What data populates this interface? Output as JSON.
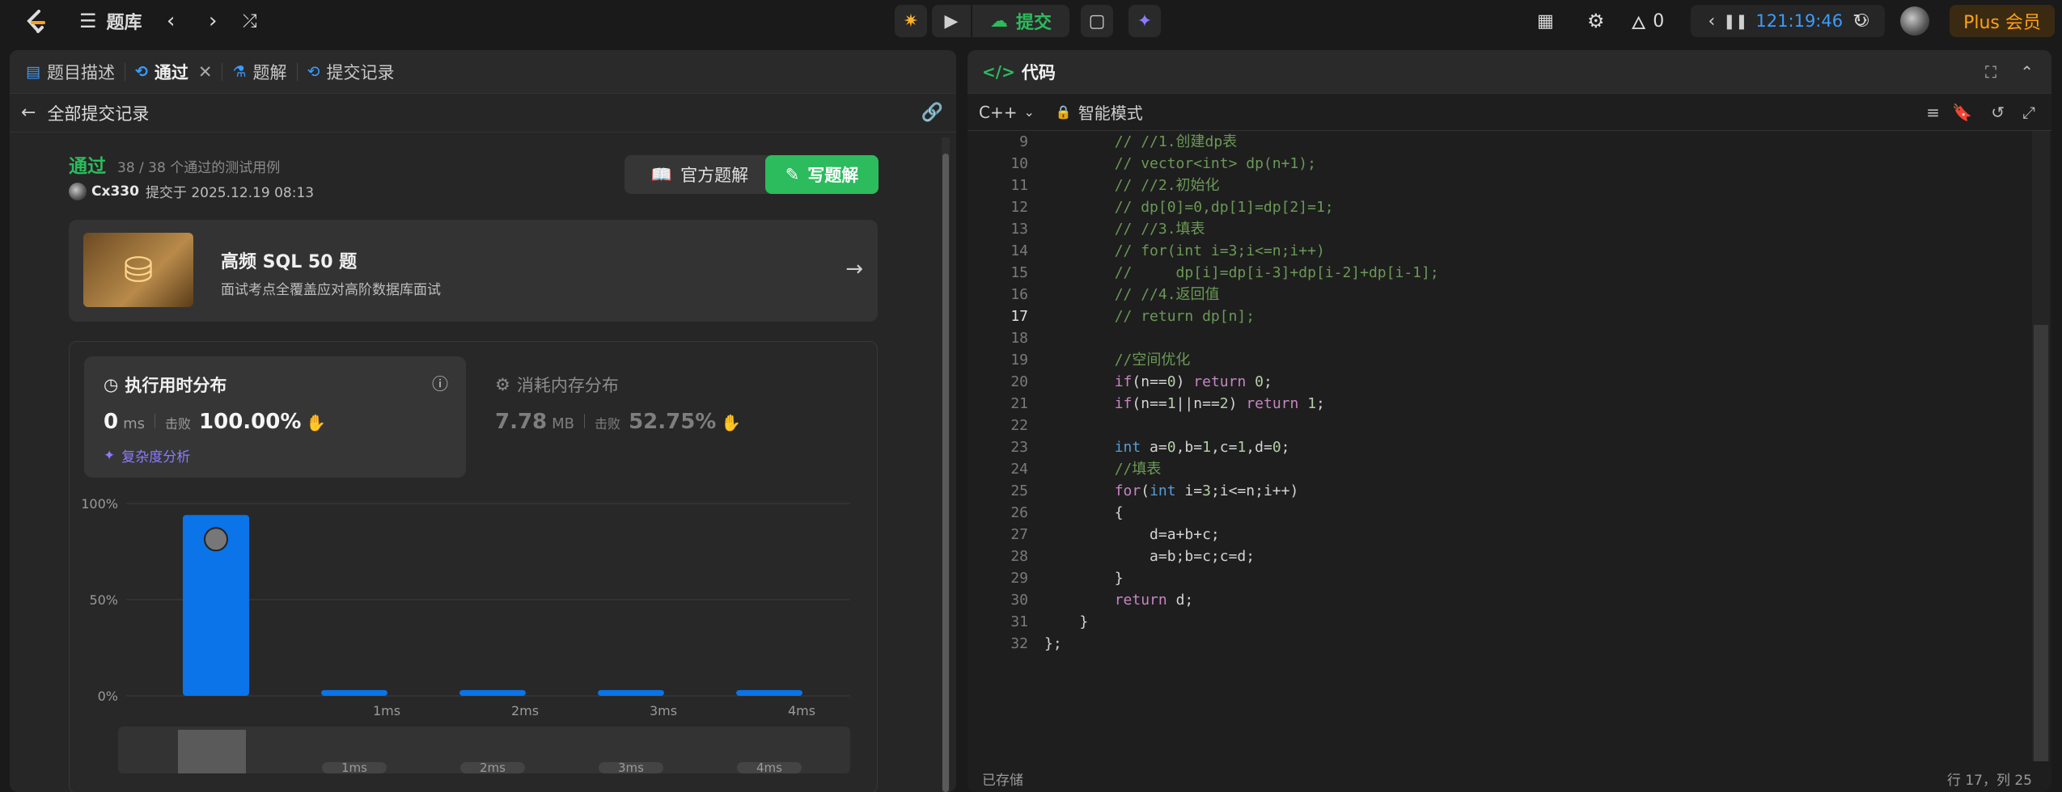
{
  "topbar": {
    "problem_bank": "题库",
    "submit": "提交",
    "fire_count": "0",
    "timer": "121:19:46",
    "plus": "Plus 会员"
  },
  "left": {
    "tabs": [
      {
        "label": "题目描述"
      },
      {
        "label": "通过"
      },
      {
        "label": "题解"
      },
      {
        "label": "提交记录"
      }
    ],
    "back_label": "全部提交记录",
    "status": "通过",
    "testcases": "38 / 38 个通过的测试用例",
    "user": "Cx330",
    "submitted_at": "提交于 2025.12.19 08:13",
    "official_solution": "官方题解",
    "write_solution": "写题解",
    "promo": {
      "title": "高频 SQL 50 题",
      "subtitle": "面试考点全覆盖应对高阶数据库面试"
    },
    "runtime": {
      "title": "执行用时分布",
      "value": "0",
      "unit": "ms",
      "beats_label": "击败",
      "beats": "100.00%",
      "complexity": "复杂度分析"
    },
    "memory": {
      "title": "消耗内存分布",
      "value": "7.78",
      "unit": "MB",
      "beats_label": "击败",
      "beats": "52.75%"
    },
    "chart_data": {
      "type": "bar",
      "categories": [
        "",
        "1ms",
        "2ms",
        "3ms",
        "4ms"
      ],
      "values": [
        94,
        3,
        3,
        3,
        3
      ],
      "y_ticks": [
        "100%",
        "50%",
        "0%"
      ],
      "ylim": [
        0,
        100
      ],
      "bar_color": "#0a74e8",
      "brush_labels": [
        "1ms",
        "2ms",
        "3ms",
        "4ms"
      ]
    }
  },
  "right": {
    "title": "代码",
    "language": "C++",
    "mode": "智能模式",
    "saved": "已存储",
    "cursor": "行 17，列 25",
    "current_line": 17,
    "lines": [
      {
        "n": "9",
        "parts": [
          {
            "t": "        // //1.创建dp表",
            "c": "cm"
          }
        ]
      },
      {
        "n": "10",
        "parts": [
          {
            "t": "        // vector<int> dp(n+1);",
            "c": "cm"
          }
        ]
      },
      {
        "n": "11",
        "parts": [
          {
            "t": "        // //2.初始化",
            "c": "cm"
          }
        ]
      },
      {
        "n": "12",
        "parts": [
          {
            "t": "        // dp[0]=0,dp[1]=dp[2]=1;",
            "c": "cm"
          }
        ]
      },
      {
        "n": "13",
        "parts": [
          {
            "t": "        // //3.填表",
            "c": "cm"
          }
        ]
      },
      {
        "n": "14",
        "parts": [
          {
            "t": "        // for(int i=3;i<=n;i++)",
            "c": "cm"
          }
        ]
      },
      {
        "n": "15",
        "parts": [
          {
            "t": "        //     dp[i]=dp[i-3]+dp[i-2]+dp[i-1];",
            "c": "cm"
          }
        ]
      },
      {
        "n": "16",
        "parts": [
          {
            "t": "        // //4.返回值",
            "c": "cm"
          }
        ]
      },
      {
        "n": "17",
        "parts": [
          {
            "t": "        // return dp[n];",
            "c": "cm"
          }
        ]
      },
      {
        "n": "18",
        "parts": []
      },
      {
        "n": "19",
        "parts": [
          {
            "t": "        //空间优化",
            "c": "cm"
          }
        ]
      },
      {
        "n": "20",
        "parts": [
          {
            "t": "        ",
            "c": "df"
          },
          {
            "t": "if",
            "c": "kw"
          },
          {
            "t": "(n==",
            "c": "df"
          },
          {
            "t": "0",
            "c": "nm"
          },
          {
            "t": ") ",
            "c": "df"
          },
          {
            "t": "return",
            "c": "kw"
          },
          {
            "t": " ",
            "c": "df"
          },
          {
            "t": "0",
            "c": "nm"
          },
          {
            "t": ";",
            "c": "df"
          }
        ]
      },
      {
        "n": "21",
        "parts": [
          {
            "t": "        ",
            "c": "df"
          },
          {
            "t": "if",
            "c": "kw"
          },
          {
            "t": "(n==",
            "c": "df"
          },
          {
            "t": "1",
            "c": "nm"
          },
          {
            "t": "||n==",
            "c": "df"
          },
          {
            "t": "2",
            "c": "nm"
          },
          {
            "t": ") ",
            "c": "df"
          },
          {
            "t": "return",
            "c": "kw"
          },
          {
            "t": " ",
            "c": "df"
          },
          {
            "t": "1",
            "c": "nm"
          },
          {
            "t": ";",
            "c": "df"
          }
        ]
      },
      {
        "n": "22",
        "parts": []
      },
      {
        "n": "23",
        "parts": [
          {
            "t": "        ",
            "c": "df"
          },
          {
            "t": "int",
            "c": "ty"
          },
          {
            "t": " a=",
            "c": "df"
          },
          {
            "t": "0",
            "c": "nm"
          },
          {
            "t": ",b=",
            "c": "df"
          },
          {
            "t": "1",
            "c": "nm"
          },
          {
            "t": ",c=",
            "c": "df"
          },
          {
            "t": "1",
            "c": "nm"
          },
          {
            "t": ",d=",
            "c": "df"
          },
          {
            "t": "0",
            "c": "nm"
          },
          {
            "t": ";",
            "c": "df"
          }
        ]
      },
      {
        "n": "24",
        "parts": [
          {
            "t": "        //填表",
            "c": "cm"
          }
        ]
      },
      {
        "n": "25",
        "parts": [
          {
            "t": "        ",
            "c": "df"
          },
          {
            "t": "for",
            "c": "kw"
          },
          {
            "t": "(",
            "c": "df"
          },
          {
            "t": "int",
            "c": "ty"
          },
          {
            "t": " i=",
            "c": "df"
          },
          {
            "t": "3",
            "c": "nm"
          },
          {
            "t": ";i<=n;i++)",
            "c": "df"
          }
        ]
      },
      {
        "n": "26",
        "parts": [
          {
            "t": "        {",
            "c": "df"
          }
        ]
      },
      {
        "n": "27",
        "parts": [
          {
            "t": "            d=a+b+c;",
            "c": "df"
          }
        ]
      },
      {
        "n": "28",
        "parts": [
          {
            "t": "            a=b;b=c;c=d;",
            "c": "df"
          }
        ]
      },
      {
        "n": "29",
        "parts": [
          {
            "t": "        }",
            "c": "df"
          }
        ]
      },
      {
        "n": "30",
        "parts": [
          {
            "t": "        ",
            "c": "df"
          },
          {
            "t": "return",
            "c": "kw"
          },
          {
            "t": " d;",
            "c": "df"
          }
        ]
      },
      {
        "n": "31",
        "parts": [
          {
            "t": "    }",
            "c": "df"
          }
        ]
      },
      {
        "n": "32",
        "parts": [
          {
            "t": "};",
            "c": "df"
          }
        ]
      }
    ]
  }
}
